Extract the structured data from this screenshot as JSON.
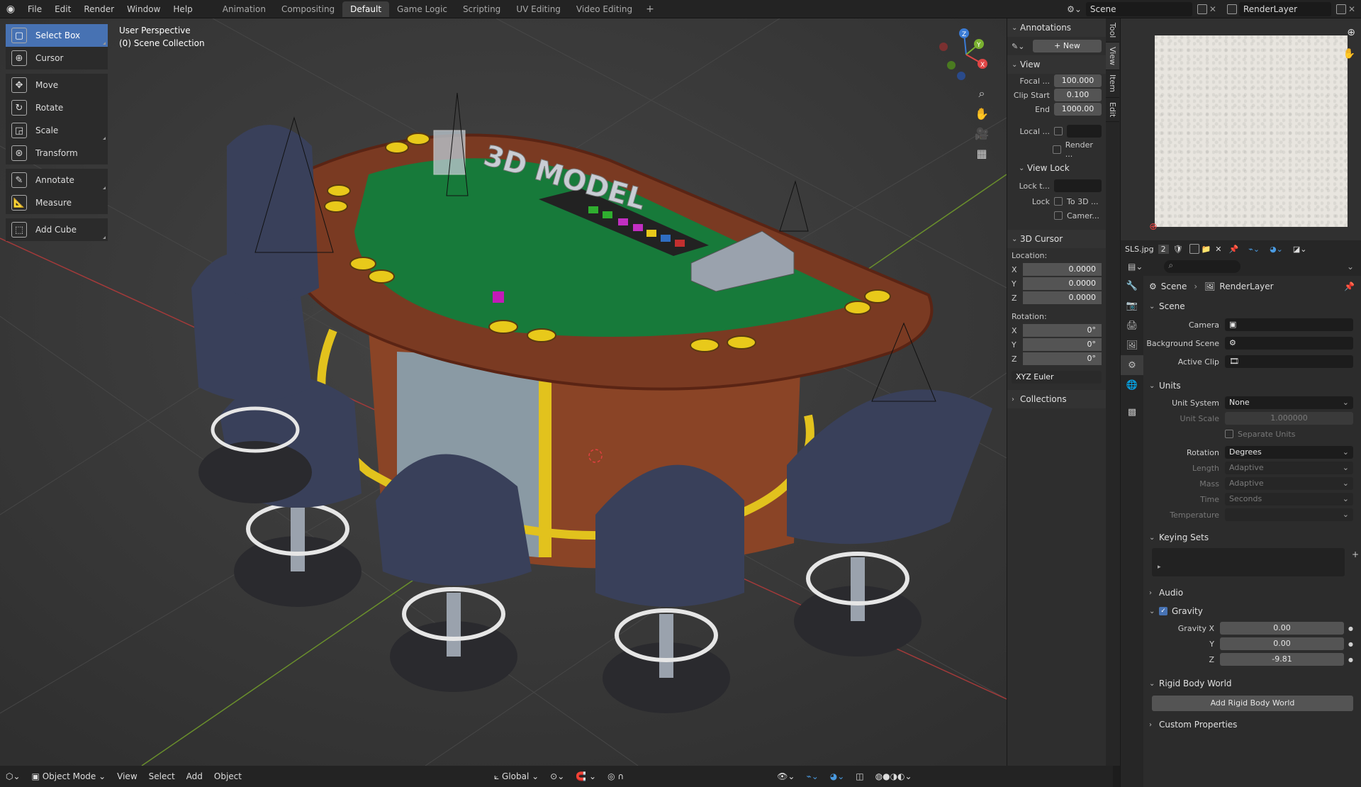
{
  "menu": {
    "file": "File",
    "edit": "Edit",
    "render": "Render",
    "window": "Window",
    "help": "Help"
  },
  "workspaces": [
    "Animation",
    "Compositing",
    "Default",
    "Game Logic",
    "Scripting",
    "UV Editing",
    "Video Editing"
  ],
  "active_workspace": "Default",
  "scene_field": "Scene",
  "view_layer_field": "RenderLayer",
  "tools": [
    {
      "label": "Select Box",
      "icon": "select-box-icon",
      "active": true
    },
    {
      "label": "Cursor",
      "icon": "cursor-icon"
    },
    {
      "label": "Move",
      "icon": "move-icon"
    },
    {
      "label": "Rotate",
      "icon": "rotate-icon"
    },
    {
      "label": "Scale",
      "icon": "scale-icon"
    },
    {
      "label": "Transform",
      "icon": "transform-icon"
    },
    {
      "label": "Annotate",
      "icon": "annotate-icon"
    },
    {
      "label": "Measure",
      "icon": "measure-icon"
    },
    {
      "label": "Add Cube",
      "icon": "add-cube-icon"
    }
  ],
  "viewport": {
    "perspective": "User Perspective",
    "collection": "(0) Scene Collection",
    "model_sign": "3D MODEL"
  },
  "npanel": {
    "annotations": "Annotations",
    "new_btn": "New",
    "view": "View",
    "focal_lbl": "Focal ...",
    "focal": "100.000",
    "clip_start_lbl": "Clip Start",
    "clip_start": "0.100",
    "end_lbl": "End",
    "end": "1000.00",
    "local_lbl": "Local ...",
    "render_lbl": "Render ...",
    "view_lock": "View Lock",
    "lock_to_lbl": "Lock t...",
    "lock_lbl": "Lock",
    "to3d": "To 3D ...",
    "camera": "Camer...",
    "cursor3d": "3D Cursor",
    "location": "Location:",
    "loc": {
      "x": "0.0000",
      "y": "0.0000",
      "z": "0.0000"
    },
    "rotation": "Rotation:",
    "rot": {
      "x": "0°",
      "y": "0°",
      "z": "0°"
    },
    "euler": "XYZ Euler",
    "collections": "Collections",
    "tabs": [
      "Tool",
      "View",
      "Item",
      "Edit"
    ]
  },
  "image_editor": {
    "filename": "SLS.jpg",
    "users": "2"
  },
  "props": {
    "breadcrumb_scene": "Scene",
    "breadcrumb_layer": "RenderLayer",
    "scene": "Scene",
    "camera_lbl": "Camera",
    "bg_scene_lbl": "Background Scene",
    "active_clip_lbl": "Active Clip",
    "units": "Units",
    "unit_system_lbl": "Unit System",
    "unit_system": "None",
    "unit_scale_lbl": "Unit Scale",
    "unit_scale": "1.000000",
    "separate_units": "Separate Units",
    "rotation_lbl": "Rotation",
    "rotation": "Degrees",
    "length_lbl": "Length",
    "length": "Adaptive",
    "mass_lbl": "Mass",
    "mass": "Adaptive",
    "time_lbl": "Time",
    "time": "Seconds",
    "temperature_lbl": "Temperature",
    "keying_sets": "Keying Sets",
    "audio": "Audio",
    "gravity": "Gravity",
    "gx_lbl": "Gravity X",
    "gx": "0.00",
    "gy_lbl": "Y",
    "gy": "0.00",
    "gz_lbl": "Z",
    "gz": "-9.81",
    "rigid": "Rigid Body World",
    "add_rigid": "Add Rigid Body World",
    "custom": "Custom Properties"
  },
  "footer": {
    "mode": "Object Mode",
    "view": "View",
    "select": "Select",
    "add": "Add",
    "object": "Object",
    "orientation": "Global"
  }
}
